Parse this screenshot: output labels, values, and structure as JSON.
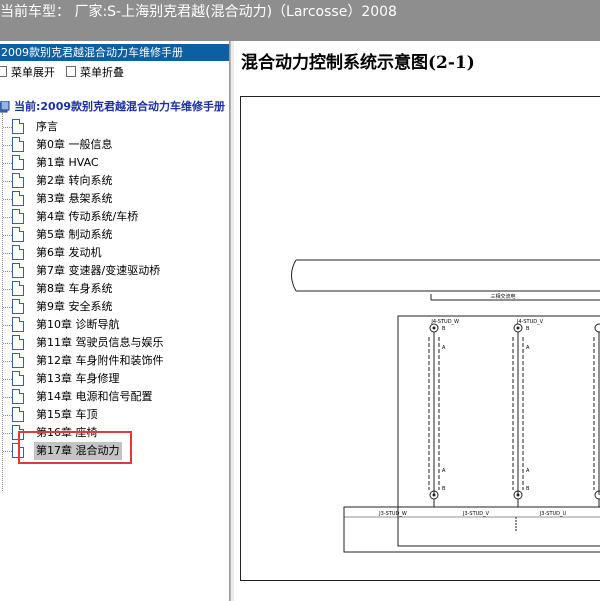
{
  "window": {
    "title": "当前车型：  厂家:S-上海别克君越(混合动力)（Larcosse）2008"
  },
  "sidebar": {
    "header": "2009款别克君越混合动力车维修手册",
    "expand_all": "菜单展开",
    "collapse_all": "菜单折叠",
    "root_label": "当前:2009款别克君越混合动力车维修手册",
    "selected_index": 18,
    "items": [
      {
        "label": "序言"
      },
      {
        "label": "第0章 一般信息"
      },
      {
        "label": "第1章 HVAC"
      },
      {
        "label": "第2章 转向系统"
      },
      {
        "label": "第3章 悬架系统"
      },
      {
        "label": "第4章 传动系统/车桥"
      },
      {
        "label": "第5章 制动系统"
      },
      {
        "label": "第6章 发动机"
      },
      {
        "label": "第7章 变速器/变速驱动桥"
      },
      {
        "label": "第8章 车身系统"
      },
      {
        "label": "第9章 安全系统"
      },
      {
        "label": "第10章 诊断导航"
      },
      {
        "label": "第11章 驾驶员信息与娱乐"
      },
      {
        "label": "第12章 车身附件和装饰件"
      },
      {
        "label": "第13章 车身修理"
      },
      {
        "label": "第14章 电源和信号配置"
      },
      {
        "label": "第15章 车顶"
      },
      {
        "label": "第16章 座椅"
      },
      {
        "label": "第17章 混合动力"
      }
    ]
  },
  "main": {
    "title": "混合动力控制系统示意图(2-1)",
    "diagram": {
      "bus_label": "三相交流电",
      "top_labels": [
        "J4-STUD_W",
        "J4-STUD_V"
      ],
      "bottom_labels": [
        "J3-STUD_W",
        "J3-STUD_V",
        "J3-STUD_U"
      ],
      "pin_top": "B",
      "pin_a": "A",
      "colors": {
        "line": "#222222",
        "highlight": "#e03a3a"
      }
    }
  }
}
